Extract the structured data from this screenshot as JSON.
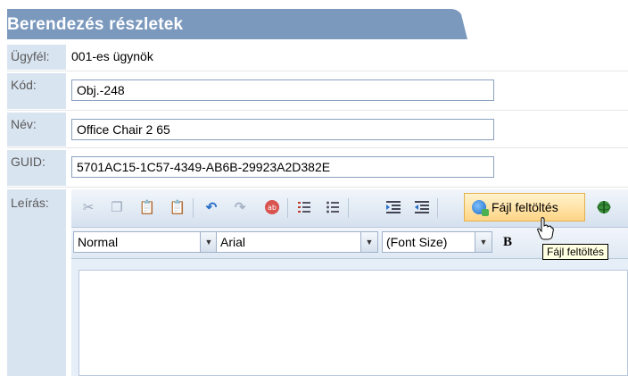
{
  "header": {
    "title": "Berendezés részletek"
  },
  "fields": {
    "ugyfel": {
      "label": "Ügyfél:",
      "value": "001-es ügynök"
    },
    "kod": {
      "label": "Kód:",
      "value": "Obj.-248"
    },
    "nev": {
      "label": "Név:",
      "value": "Office Chair 2 65"
    },
    "guid": {
      "label": "GUID:",
      "value": "5701AC15-1C57-4349-AB6B-29923A2D382E"
    },
    "leiras": {
      "label": "Leírás:"
    }
  },
  "toolbar": {
    "upload_label": "Fájl feltöltés",
    "icons": [
      "cut-icon",
      "copy-icon",
      "paste-icon",
      "paste-word-icon",
      "undo-icon",
      "redo-icon",
      "spellcheck-icon",
      "ordered-list-icon",
      "unordered-list-icon",
      "indent-icon",
      "outdent-icon"
    ],
    "paragraph_value": "Normal",
    "font_value": "Arial",
    "size_value": "(Font Size)",
    "bold_label": "B"
  },
  "tooltip": {
    "text": "Fájl feltöltés"
  },
  "colors": {
    "header_bg": "#7b98bd",
    "label_bg": "#d9e4f1",
    "upload_highlight": "#ffd586"
  }
}
